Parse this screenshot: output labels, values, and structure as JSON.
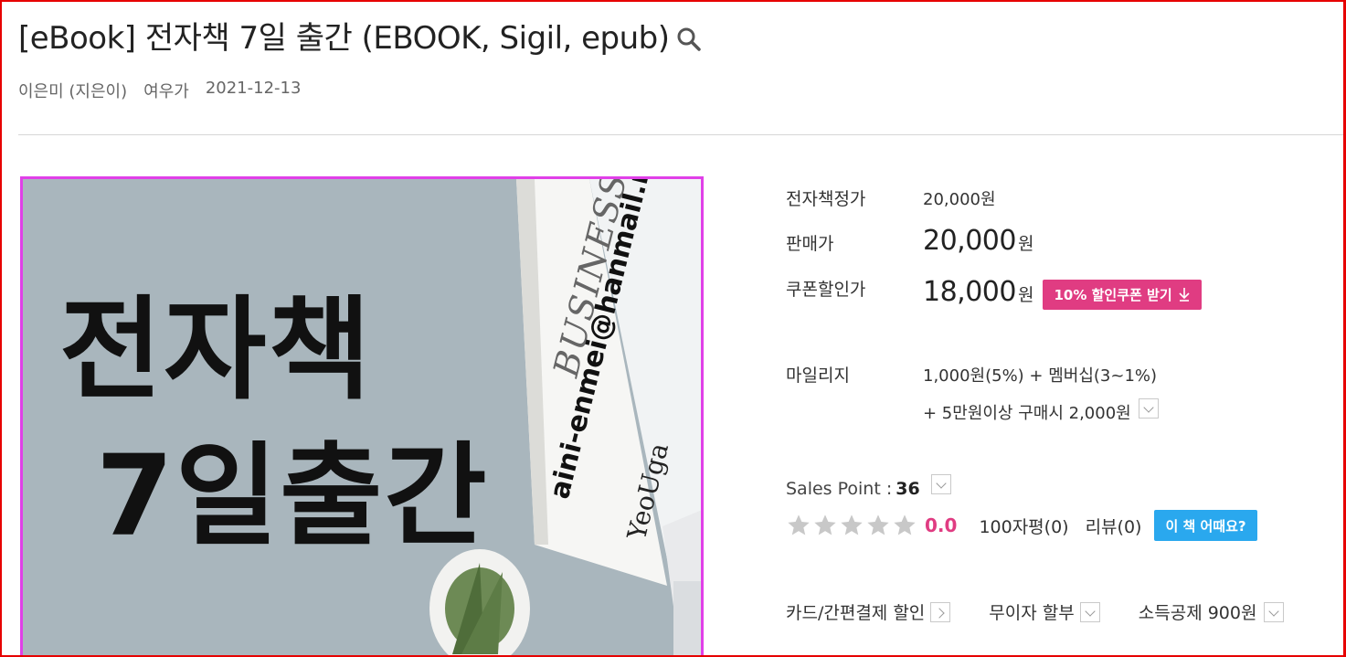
{
  "header": {
    "title": "[eBook] 전자책 7일 출간 (EBOOK, Sigil, epub)",
    "author": "이은미 (지은이)",
    "publisher": "여우가",
    "date": "2021-12-13"
  },
  "cover": {
    "line1": "전자책",
    "line2": "7일출간",
    "email": "aini-enmei@hanmail.net",
    "paper_heading": "BUSINESS",
    "brand": "YeoUga"
  },
  "price": {
    "ebook_label": "전자책정가",
    "ebook_value": "20,000원",
    "sale_label": "판매가",
    "sale_value": "20,000",
    "sale_unit": "원",
    "coupon_label": "쿠폰할인가",
    "coupon_value": "18,000",
    "coupon_unit": "원",
    "coupon_button": "10% 할인쿠폰 받기"
  },
  "mileage": {
    "label": "마일리지",
    "line1": "1,000원(5%) + 멤버십(3~1%)",
    "line2": "+ 5만원이상 구매시 2,000원"
  },
  "sales": {
    "label": "Sales Point : ",
    "value": "36"
  },
  "rating": {
    "stars_filled": 0,
    "stars_total": 5,
    "score": "0.0",
    "review100": "100자평(0)",
    "reviews": "리뷰(0)",
    "review_button": "이 책 어때요?"
  },
  "payment": {
    "card": "카드/간편결제 할인",
    "installment": "무이자 할부",
    "deduction": "소득공제 900원"
  },
  "colors": {
    "accent_pink": "#e03c82",
    "accent_blue": "#2aa8ee",
    "frame_red": "#e60000"
  }
}
